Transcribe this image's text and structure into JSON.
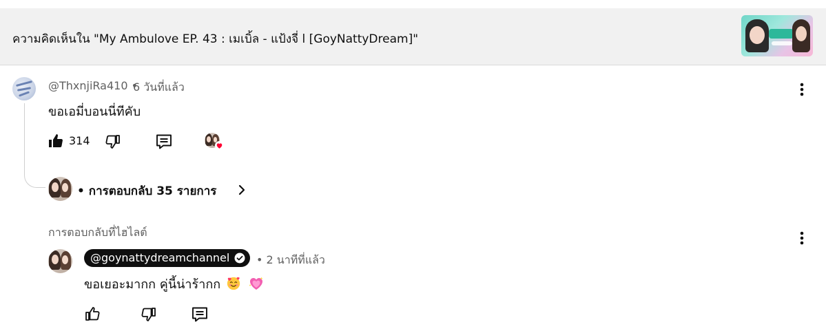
{
  "header": {
    "title": "ความคิดเห็นใน \"My Ambulove EP. 43 : เมเบิ้ล - แป้งจี่ l [GoyNattyDream]\""
  },
  "comment": {
    "author": "@ThxnjiRa410",
    "separator": "•",
    "time": "6 วันที่แล้ว",
    "text": "ขอเอมี่บอนนี่ทีคับ",
    "like_count": "314"
  },
  "replies": {
    "label": "• การตอบกลับ 35 รายการ"
  },
  "highlighted": {
    "label": "การตอบกลับที่ไฮไลต์",
    "author": "@goynattydreamchannel",
    "separator": "•",
    "time": "2 นาทีที่แล้ว",
    "text": "ขอเยอะมากก คู่นี้น่าร้ากก"
  },
  "icons": {
    "like": "thumbs-up-icon",
    "dislike": "thumbs-down-icon",
    "reply": "comment-icon",
    "more": "more-vert-icon",
    "verified": "verified-check-icon",
    "creator_heart": "heart-icon",
    "expand": "chevron-right-icon",
    "emoji_1": "smiling-face-with-hearts-emoji",
    "emoji_2": "sparkling-heart-emoji"
  },
  "colors": {
    "header_bg": "#f1f1f1",
    "text": "#0f0f0f",
    "secondary_text": "#606060",
    "pill_bg": "#0f0f0f",
    "heart": "#ff0033"
  }
}
